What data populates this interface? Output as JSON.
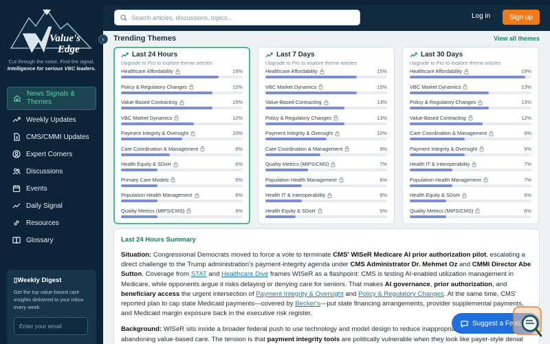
{
  "brand": {
    "name": "Value's Edge",
    "tagline_1": "Cut through the noise. Find the signal.",
    "tagline_2": "Intelligence for serious VBC leaders."
  },
  "nav": {
    "items": [
      {
        "label": "News Signals & Themes",
        "icon": "news-icon"
      },
      {
        "label": "Weekly Updates",
        "icon": "trend-icon"
      },
      {
        "label": "CMS/CMMI Updates",
        "icon": "document-icon"
      },
      {
        "label": "Expert Corners",
        "icon": "user-icon"
      },
      {
        "label": "Discussions",
        "icon": "users-icon"
      },
      {
        "label": "Events",
        "icon": "calendar-icon"
      },
      {
        "label": "Daily Signal",
        "icon": "pulse-icon"
      },
      {
        "label": "Resources",
        "icon": "link-icon"
      },
      {
        "label": "Glossary",
        "icon": "book-icon"
      }
    ]
  },
  "digest": {
    "title": "Weekly Digest",
    "text": "Get the top value-based care insights delivered to your inbox every week.",
    "placeholder": "Enter your email"
  },
  "header": {
    "search_placeholder": "Search articles, discussions, topics...",
    "login": "Log in",
    "signup": "Sign up"
  },
  "trending": {
    "title": "Trending Themes",
    "view_all": "View all themes",
    "upgrade_text": "Upgrade to Pro to explore theme articles",
    "cards": [
      {
        "title": "Last 24 Hours",
        "rows": [
          {
            "label": "Healthcare Affordability",
            "pct": "16%",
            "value": 16
          },
          {
            "label": "Policy & Regulatory Changes",
            "pct": "15%",
            "value": 15
          },
          {
            "label": "Value-Based Contracting",
            "pct": "15%",
            "value": 15
          },
          {
            "label": "VBC Market Dynamics",
            "pct": "12%",
            "value": 12
          },
          {
            "label": "Payment Integrity & Oversight",
            "pct": "10%",
            "value": 10
          },
          {
            "label": "Care Coordination & Management",
            "pct": "8%",
            "value": 8
          },
          {
            "label": "Health Equity & SDoH",
            "pct": "6%",
            "value": 6
          },
          {
            "label": "Primary Care Models",
            "pct": "6%",
            "value": 6
          },
          {
            "label": "Population Health Management",
            "pct": "6%",
            "value": 6
          },
          {
            "label": "Quality Metrics (MIPS/CMS)",
            "pct": "6%",
            "value": 6
          }
        ]
      },
      {
        "title": "Last 7 Days",
        "rows": [
          {
            "label": "Healthcare Affordability",
            "pct": "15%",
            "value": 15
          },
          {
            "label": "VBC Market Dynamics",
            "pct": "15%",
            "value": 15
          },
          {
            "label": "Value-Based Contracting",
            "pct": "13%",
            "value": 13
          },
          {
            "label": "Policy & Regulatory Changes",
            "pct": "13%",
            "value": 13
          },
          {
            "label": "Payment Integrity & Oversight",
            "pct": "10%",
            "value": 10
          },
          {
            "label": "Care Coordination & Management",
            "pct": "9%",
            "value": 9
          },
          {
            "label": "Quality Metrics (MIPS/CMS)",
            "pct": "7%",
            "value": 7
          },
          {
            "label": "Population Health Management",
            "pct": "6%",
            "value": 6
          },
          {
            "label": "Health IT & Interoperability",
            "pct": "6%",
            "value": 6
          },
          {
            "label": "Health Equity & SDoH",
            "pct": "5%",
            "value": 5
          }
        ]
      },
      {
        "title": "Last 30 Days",
        "rows": [
          {
            "label": "Healthcare Affordability",
            "pct": "19%",
            "value": 19
          },
          {
            "label": "VBC Market Dynamics",
            "pct": "13%",
            "value": 13
          },
          {
            "label": "Policy & Regulatory Changes",
            "pct": "13%",
            "value": 13
          },
          {
            "label": "Value-Based Contracting",
            "pct": "12%",
            "value": 12
          },
          {
            "label": "Care Coordination & Management",
            "pct": "9%",
            "value": 9
          },
          {
            "label": "Payment Integrity & Oversight",
            "pct": "9%",
            "value": 9
          },
          {
            "label": "Health IT & Interoperability",
            "pct": "7%",
            "value": 7
          },
          {
            "label": "Population Health Management",
            "pct": "7%",
            "value": 7
          },
          {
            "label": "Health Equity & SDoH",
            "pct": "6%",
            "value": 6
          },
          {
            "label": "Quality Metrics (MIPS/CMS)",
            "pct": "6%",
            "value": 6
          }
        ]
      }
    ]
  },
  "summary": {
    "title": "Last 24 Hours Summary",
    "situation_label": "Situation:",
    "situation": [
      {
        "t": "text",
        "v": " Congressional Democrats moved to force a vote to terminate "
      },
      {
        "t": "bold",
        "v": "CMS' WISeR Medicare AI prior authorization pilot"
      },
      {
        "t": "text",
        "v": ", escalating a direct challenge to the Trump administration's payment-integrity agenda under "
      },
      {
        "t": "bold",
        "v": "CMS Administrator Dr. Mehmet Oz"
      },
      {
        "t": "text",
        "v": " and "
      },
      {
        "t": "bold",
        "v": "CMMI Director Abe Sutton"
      },
      {
        "t": "text",
        "v": ". Coverage from "
      },
      {
        "t": "link",
        "v": "STAT"
      },
      {
        "t": "text",
        "v": " and "
      },
      {
        "t": "link",
        "v": "Healthcare Dive"
      },
      {
        "t": "text",
        "v": " frames WISeR as a flashpoint: CMS is testing AI-enabled utilization management in Medicare, while opponents argue it risks delaying or denying care for seniors. That makes "
      },
      {
        "t": "bold",
        "v": "AI governance"
      },
      {
        "t": "text",
        "v": ", "
      },
      {
        "t": "bold",
        "v": "prior authorization"
      },
      {
        "t": "text",
        "v": ", and "
      },
      {
        "t": "bold",
        "v": "beneficiary access"
      },
      {
        "t": "text",
        "v": " the urgent intersection of "
      },
      {
        "t": "link",
        "v": "Payment Integrity & Oversight"
      },
      {
        "t": "text",
        "v": " and "
      },
      {
        "t": "link",
        "v": "Policy & Regulatory Changes"
      },
      {
        "t": "text",
        "v": ". At the same time, CMS' reported plan to cap state Medicaid payments—covered by "
      },
      {
        "t": "link",
        "v": "Becker's"
      },
      {
        "t": "text",
        "v": "—put state financing arrangements, provider supplemental payments, and Medicaid margin exposure back in the executive risk register."
      }
    ],
    "background_label": "Background:",
    "background": [
      {
        "t": "text",
        "v": " WISeR sits inside a broader federal push to use technology and model design to reduce inappropriate spending without abandoning value-based care. The tension is that "
      },
      {
        "t": "bold",
        "v": "payment integrity tools"
      },
      {
        "t": "text",
        "v": " are politically vulnerable when they look like payer-style denial"
      }
    ]
  },
  "suggest_button": "Suggest a Feature",
  "colors": {
    "sidebar": "#0d2438",
    "accent": "#3ec28e",
    "signup": "#ef7b18",
    "bar": "#7a8fd3",
    "suggest": "#1f6fdc"
  }
}
